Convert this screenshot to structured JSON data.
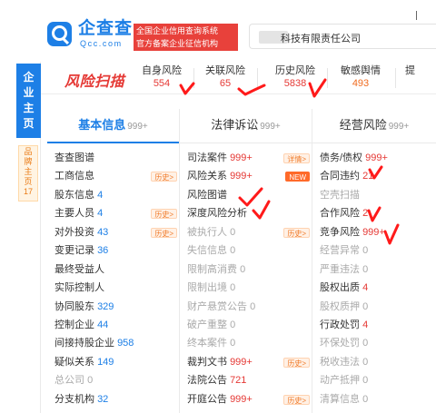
{
  "brand": {
    "name": "企查查",
    "sub": "Qcc.com",
    "tagline_1": "全国企业信用查询系统",
    "tagline_2": "官方备案企业征信机构"
  },
  "search": {
    "query": "科技有限责任公司"
  },
  "riskbar": {
    "logo": "风险扫描",
    "tabs": [
      {
        "label": "自身风险",
        "count": "554"
      },
      {
        "label": "关联风险",
        "count": "65"
      },
      {
        "label": "历史风险",
        "count": "5838"
      },
      {
        "label": "敏感舆情",
        "count": "493"
      },
      {
        "label": "提",
        "count": ""
      }
    ]
  },
  "rail": {
    "main": "企业主页",
    "sub": "品牌主页",
    "sub_count": "17"
  },
  "columns": [
    {
      "title": "基本信息",
      "count": "999+",
      "items": [
        {
          "label": "查查图谱",
          "num": "",
          "badge": "",
          "dim": false
        },
        {
          "label": "工商信息",
          "num": "",
          "badge": "历史>",
          "dim": false
        },
        {
          "label": "股东信息",
          "num": "4",
          "badge": "",
          "dim": false
        },
        {
          "label": "主要人员",
          "num": "4",
          "badge": "历史>",
          "dim": false
        },
        {
          "label": "对外投资",
          "num": "43",
          "badge": "历史>",
          "dim": false
        },
        {
          "label": "变更记录",
          "num": "36",
          "badge": "",
          "dim": false
        },
        {
          "label": "最终受益人",
          "num": "",
          "badge": "",
          "dim": false
        },
        {
          "label": "实际控制人",
          "num": "",
          "badge": "",
          "dim": false
        },
        {
          "label": "协同股东",
          "num": "329",
          "badge": "",
          "dim": false
        },
        {
          "label": "控制企业",
          "num": "44",
          "badge": "",
          "dim": false
        },
        {
          "label": "间接持股企业",
          "num": "958",
          "badge": "",
          "dim": false
        },
        {
          "label": "疑似关系",
          "num": "149",
          "badge": "",
          "dim": false
        },
        {
          "label": "总公司",
          "num": "0",
          "badge": "",
          "dim": true
        },
        {
          "label": "分支机构",
          "num": "32",
          "badge": "",
          "dim": false
        }
      ]
    },
    {
      "title": "法律诉讼",
      "count": "999+",
      "items": [
        {
          "label": "司法案件",
          "num": "999+",
          "badge": "详情>",
          "dim": false
        },
        {
          "label": "风险关系",
          "num": "999+",
          "badge": "NEW",
          "dim": false
        },
        {
          "label": "风险图谱",
          "num": "",
          "badge": "",
          "dim": false
        },
        {
          "label": "深度风险分析",
          "num": "",
          "badge": "",
          "dim": false
        },
        {
          "label": "被执行人",
          "num": "0",
          "badge": "历史>",
          "dim": true
        },
        {
          "label": "失信信息",
          "num": "0",
          "badge": "",
          "dim": true
        },
        {
          "label": "限制高消费",
          "num": "0",
          "badge": "",
          "dim": true
        },
        {
          "label": "限制出境",
          "num": "0",
          "badge": "",
          "dim": true
        },
        {
          "label": "财产悬赏公告",
          "num": "0",
          "badge": "",
          "dim": true
        },
        {
          "label": "破产重整",
          "num": "0",
          "badge": "",
          "dim": true
        },
        {
          "label": "终本案件",
          "num": "0",
          "badge": "",
          "dim": true
        },
        {
          "label": "裁判文书",
          "num": "999+",
          "badge": "历史>",
          "dim": false
        },
        {
          "label": "法院公告",
          "num": "721",
          "badge": "",
          "dim": false
        },
        {
          "label": "开庭公告",
          "num": "999+",
          "badge": "历史>",
          "dim": false
        }
      ]
    },
    {
      "title": "经营风险",
      "count": "999+",
      "items": [
        {
          "label": "债务/债权",
          "num": "999+",
          "badge": "",
          "dim": false
        },
        {
          "label": "合同违约",
          "num": "21",
          "badge": "",
          "dim": false
        },
        {
          "label": "空壳扫描",
          "num": "",
          "badge": "",
          "dim": true
        },
        {
          "label": "合作风险",
          "num": "2",
          "badge": "",
          "dim": false
        },
        {
          "label": "竞争风险",
          "num": "999+",
          "badge": "",
          "dim": false
        },
        {
          "label": "经营异常",
          "num": "0",
          "badge": "",
          "dim": true
        },
        {
          "label": "严重违法",
          "num": "0",
          "badge": "",
          "dim": true
        },
        {
          "label": "股权出质",
          "num": "4",
          "badge": "",
          "dim": false
        },
        {
          "label": "股权质押",
          "num": "0",
          "badge": "",
          "dim": true
        },
        {
          "label": "行政处罚",
          "num": "4",
          "badge": "",
          "dim": false
        },
        {
          "label": "环保处罚",
          "num": "0",
          "badge": "",
          "dim": true
        },
        {
          "label": "税收违法",
          "num": "0",
          "badge": "",
          "dim": true
        },
        {
          "label": "动产抵押",
          "num": "0",
          "badge": "",
          "dim": true
        },
        {
          "label": "清算信息",
          "num": "0",
          "badge": "",
          "dim": true
        }
      ]
    }
  ],
  "colors": {
    "brand_blue": "#1d7fe6",
    "risk_red": "#e53935",
    "badge_orange": "#f07b2a",
    "annotation_red": "#ff1a1a"
  },
  "icons": [
    "qcc-logo-icon",
    "handwritten-check-mark"
  ]
}
